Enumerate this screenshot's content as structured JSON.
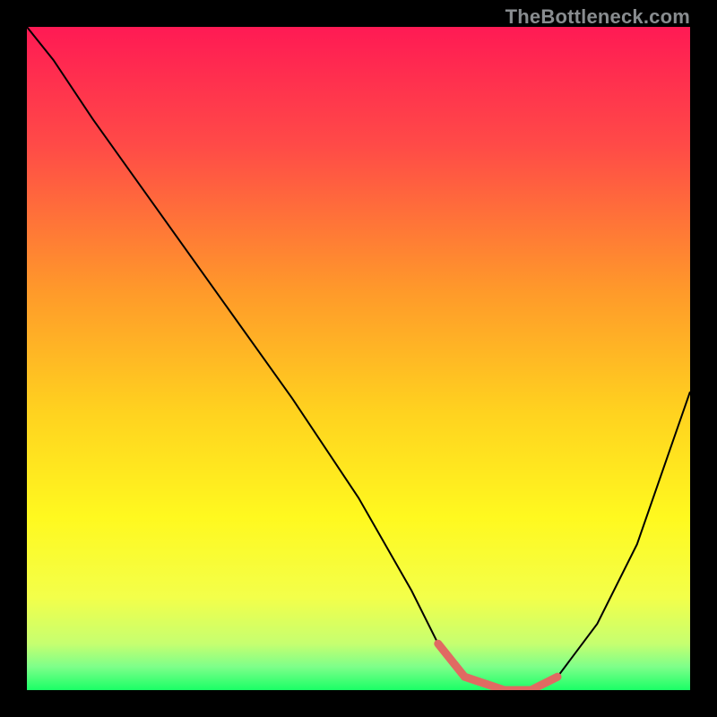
{
  "watermark": "TheBottleneck.com",
  "chart_data": {
    "type": "line",
    "title": "",
    "xlabel": "",
    "ylabel": "",
    "xlim": [
      0,
      100
    ],
    "ylim": [
      0,
      100
    ],
    "grid": false,
    "legend": false,
    "background_gradient": {
      "stops": [
        {
          "offset": 0.0,
          "color": "#ff1a54"
        },
        {
          "offset": 0.18,
          "color": "#ff4b47"
        },
        {
          "offset": 0.4,
          "color": "#ff9a2a"
        },
        {
          "offset": 0.58,
          "color": "#ffd21f"
        },
        {
          "offset": 0.74,
          "color": "#fff91f"
        },
        {
          "offset": 0.86,
          "color": "#f3ff4a"
        },
        {
          "offset": 0.93,
          "color": "#c6ff70"
        },
        {
          "offset": 0.965,
          "color": "#7dff8a"
        },
        {
          "offset": 1.0,
          "color": "#1aff66"
        }
      ]
    },
    "series": [
      {
        "name": "bottleneck-curve",
        "color": "#000000",
        "width": 2,
        "x": [
          0,
          4,
          10,
          20,
          30,
          40,
          50,
          58,
          62,
          66,
          72,
          76,
          80,
          86,
          92,
          100
        ],
        "y": [
          100,
          95,
          86,
          72,
          58,
          44,
          29,
          15,
          7,
          2,
          0,
          0,
          2,
          10,
          22,
          45
        ]
      }
    ],
    "highlight_segment": {
      "name": "valley-highlight",
      "color": "#e06a62",
      "width": 9,
      "x": [
        62,
        66,
        72,
        76,
        80
      ],
      "y": [
        7,
        2,
        0,
        0,
        2
      ]
    }
  }
}
